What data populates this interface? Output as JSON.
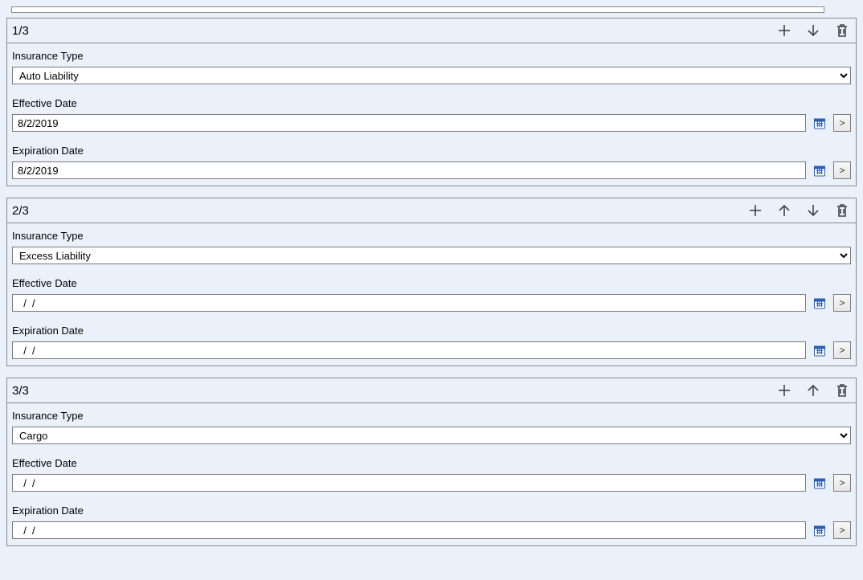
{
  "records": [
    {
      "counter": "1/3",
      "showUp": false,
      "showDown": true,
      "labels": {
        "insuranceType": "Insurance Type",
        "effective": "Effective Date",
        "expiration": "Expiration Date"
      },
      "insuranceType": "Auto Liability",
      "effectiveDate": "8/2/2019",
      "expirationDate": "8/2/2019"
    },
    {
      "counter": "2/3",
      "showUp": true,
      "showDown": true,
      "labels": {
        "insuranceType": "Insurance Type",
        "effective": "Effective Date",
        "expiration": "Expiration Date"
      },
      "insuranceType": "Excess Liability",
      "effectiveDate": "  /  /",
      "expirationDate": "  /  /"
    },
    {
      "counter": "3/3",
      "showUp": true,
      "showDown": false,
      "labels": {
        "insuranceType": "Insurance Type",
        "effective": "Effective Date",
        "expiration": "Expiration Date"
      },
      "insuranceType": "Cargo",
      "effectiveDate": "  /  /",
      "expirationDate": "  /  /"
    }
  ],
  "chevron": ">",
  "insuranceOptions": [
    "Auto Liability",
    "Excess Liability",
    "Cargo"
  ]
}
